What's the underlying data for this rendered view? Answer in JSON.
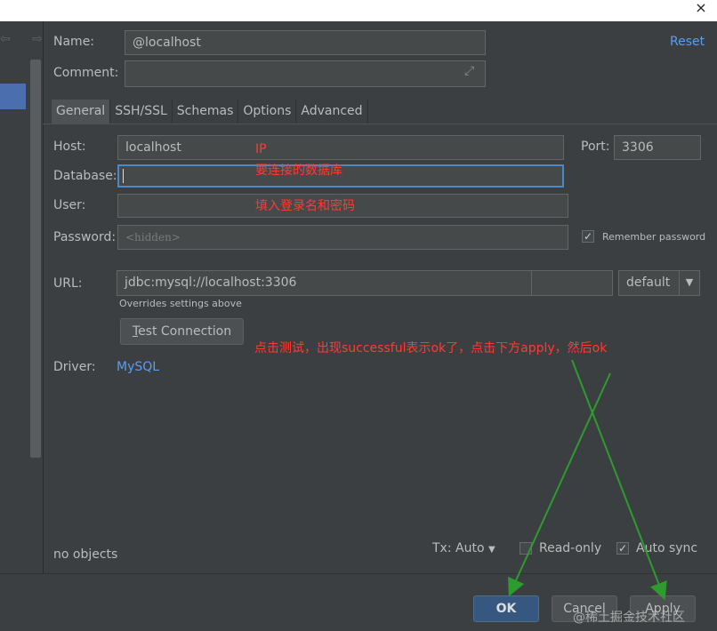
{
  "window": {
    "close_glyph": "×"
  },
  "nav": {
    "arrows": "⇦ ⇨"
  },
  "form": {
    "name_label": "Name:",
    "name_value": "@localhost",
    "reset_label": "Reset",
    "comment_label": "Comment:",
    "comment_value": "",
    "expand_icon": "⤢"
  },
  "tabs": [
    "General",
    "SSH/SSL",
    "Schemas",
    "Options",
    "Advanced"
  ],
  "general": {
    "host_label": "Host:",
    "host_value": "localhost",
    "port_label": "Port:",
    "port_value": "3306",
    "database_label": "Database:",
    "database_value": "",
    "user_label": "User:",
    "user_value": "",
    "password_label": "Password:",
    "password_placeholder": "<hidden>",
    "remember_label": "Remember password",
    "remember_checked": true,
    "url_label": "URL:",
    "url_value": "jdbc:mysql://localhost:3306",
    "url_mode": "default",
    "overrides_note": "Overrides settings above",
    "test_button": "Test Connection",
    "driver_label": "Driver:",
    "driver_value": "MySQL"
  },
  "annotations": {
    "ip": "IP",
    "database": "要连接的数据库",
    "credentials": "填入登录名和密码",
    "test_hint": "点击测试，出现successful表示ok了，点击下方apply，然后ok"
  },
  "status": {
    "objects": "no objects",
    "tx_label": "Tx: Auto",
    "readonly_label": "Read-only",
    "readonly_checked": false,
    "autosync_label": "Auto sync",
    "autosync_checked": true
  },
  "buttons": {
    "ok": "OK",
    "cancel": "Cancel",
    "apply": "Apply"
  },
  "watermark": "@稀土掘金技术社区",
  "colors": {
    "accent": "#4a88c7",
    "link": "#589df6",
    "annotation": "#ff3b30",
    "arrow": "#2e9b2e"
  }
}
